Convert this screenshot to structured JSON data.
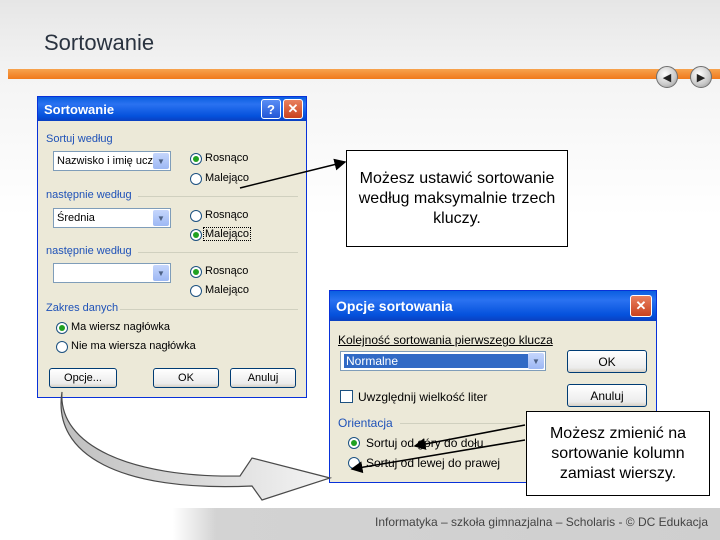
{
  "slide": {
    "title": "Sortowanie",
    "footer": "Informatyka – szkoła gimnazjalna – Scholaris - © DC Edukacja",
    "nav": {
      "prev_icon": "◀",
      "next_icon": "▶"
    }
  },
  "sort_dialog": {
    "title": "Sortowanie",
    "help_icon": "?",
    "close_icon": "✕",
    "groups": [
      {
        "label": "Sortuj według",
        "field": "Nazwisko i imię uczni",
        "asc": "Rosnąco",
        "desc": "Malejąco",
        "selected": "asc"
      },
      {
        "label": "następnie według",
        "field": "Średnia",
        "asc": "Rosnąco",
        "desc": "Malejąco",
        "selected": "desc"
      },
      {
        "label": "następnie według",
        "field": "",
        "asc": "Rosnąco",
        "desc": "Malejąco",
        "selected": "asc"
      }
    ],
    "range_label": "Zakres danych",
    "range_options": [
      "Ma wiersz nagłówka",
      "Nie ma wiersza nagłówka"
    ],
    "range_selected": 0,
    "buttons": {
      "options": "Opcje...",
      "ok": "OK",
      "cancel": "Anuluj"
    }
  },
  "options_dialog": {
    "title": "Opcje sortowania",
    "close_icon": "✕",
    "order_label": "Kolejność sortowania pierwszego klucza",
    "order_value": "Normalne",
    "case_label": "Uwzględnij wielkość liter",
    "orientation_label": "Orientacja",
    "orientation_options": [
      "Sortuj od góry do dołu",
      "Sortuj od lewej do prawej"
    ],
    "orientation_selected": 0,
    "buttons": {
      "ok": "OK",
      "cancel": "Anuluj"
    }
  },
  "callouts": {
    "top": "Możesz ustawić sortowanie według maksymalnie trzech kluczy.",
    "bottom": "Możesz zmienić na sortowanie kolumn zamiast wierszy."
  },
  "colors": {
    "accent_bar": "#f07a1c",
    "xp_title": "#0451dc",
    "group_label": "#1f52b8"
  }
}
